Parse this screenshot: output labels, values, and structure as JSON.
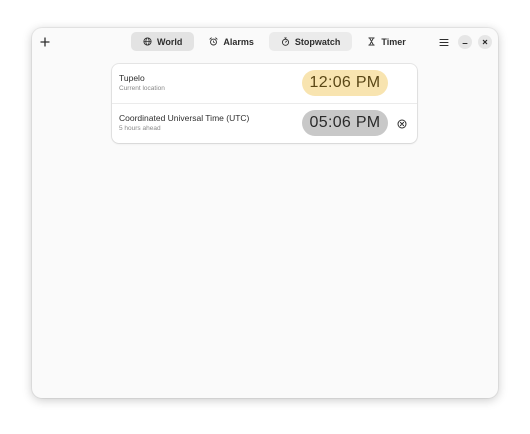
{
  "header": {
    "tabs": [
      {
        "label": "World",
        "icon": "globe-icon",
        "active": true
      },
      {
        "label": "Alarms",
        "icon": "alarm-clock-icon",
        "active": false
      },
      {
        "label": "Stopwatch",
        "icon": "stopwatch-icon",
        "active": false
      },
      {
        "label": "Timer",
        "icon": "hourglass-icon",
        "active": false
      }
    ],
    "icons": {
      "add": "plus-icon",
      "menu": "hamburger-menu-icon",
      "minimize": "minimize-icon",
      "close": "close-icon"
    }
  },
  "clocks": [
    {
      "city": "Tupelo",
      "subtitle": "Current location",
      "time": "12:06 PM",
      "period": "day"
    },
    {
      "city": "Coordinated Universal Time (UTC)",
      "subtitle": "5 hours ahead",
      "time": "05:06 PM",
      "period": "night"
    }
  ],
  "colors": {
    "window_bg": "#fafafa",
    "day_pill": "#f8e4b0",
    "night_pill": "#c8c8c8",
    "active_tab": "#e3e3e3"
  }
}
